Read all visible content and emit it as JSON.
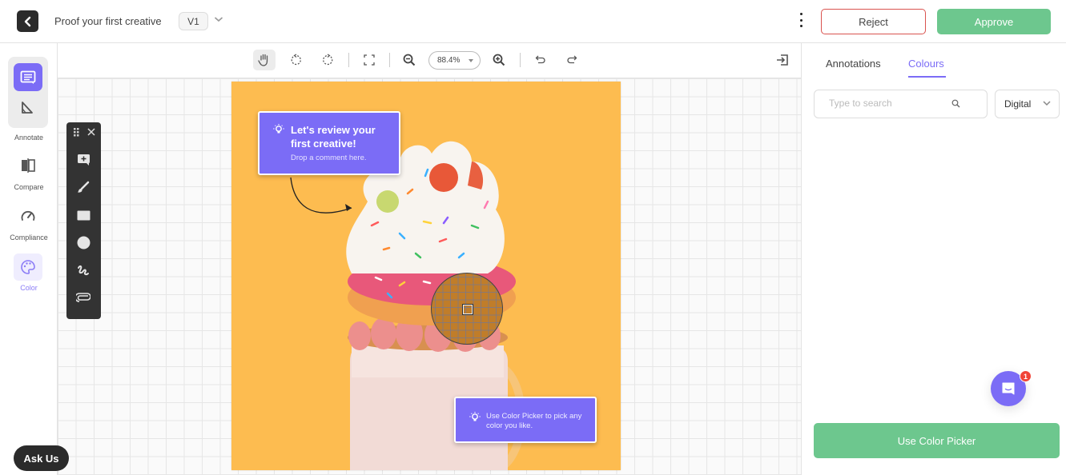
{
  "header": {
    "title": "Proof your first creative",
    "version": "V1",
    "reject_label": "Reject",
    "approve_label": "Approve"
  },
  "leftnav": {
    "items": [
      {
        "label": "Annotate",
        "icon": "comment-icon",
        "active": false
      },
      {
        "label": "Compare",
        "icon": "compare-icon",
        "active": false
      },
      {
        "label": "Compliance",
        "icon": "gauge-icon",
        "active": false
      },
      {
        "label": "Color",
        "icon": "palette-icon",
        "active": true
      }
    ]
  },
  "toolbar": {
    "zoom_level": "88.4%",
    "tools": [
      "hand-icon",
      "rotate-left-icon",
      "rotate-right-icon",
      "fit-screen-icon",
      "zoom-out-icon",
      "zoom-in-icon",
      "undo-icon",
      "redo-icon",
      "exit-panel-icon"
    ]
  },
  "tool_palette": {
    "tools": [
      "add-comment-icon",
      "brush-icon",
      "rectangle-icon",
      "circle-icon",
      "freehand-icon",
      "attachment-icon"
    ]
  },
  "canvas": {
    "tooltip_1": {
      "title": "Let's review your first creative!",
      "subtitle": "Drop a comment here."
    },
    "tooltip_2": {
      "text": "Use Color Picker to pick any color you like."
    },
    "artboard_bg": "#fdbc50",
    "picked_color": "#c07d2a"
  },
  "rightpanel": {
    "tabs": [
      {
        "label": "Annotations",
        "active": false
      },
      {
        "label": "Colours",
        "active": true
      }
    ],
    "search_placeholder": "Type to search",
    "search_value": "",
    "color_mode": "Digital",
    "use_picker_label": "Use Color Picker"
  },
  "chat": {
    "badge_count": "1"
  },
  "ask_us_label": "Ask Us",
  "colors": {
    "accent": "#7b6cf6",
    "approve": "#6dc78e",
    "reject_border": "#d9534f"
  }
}
